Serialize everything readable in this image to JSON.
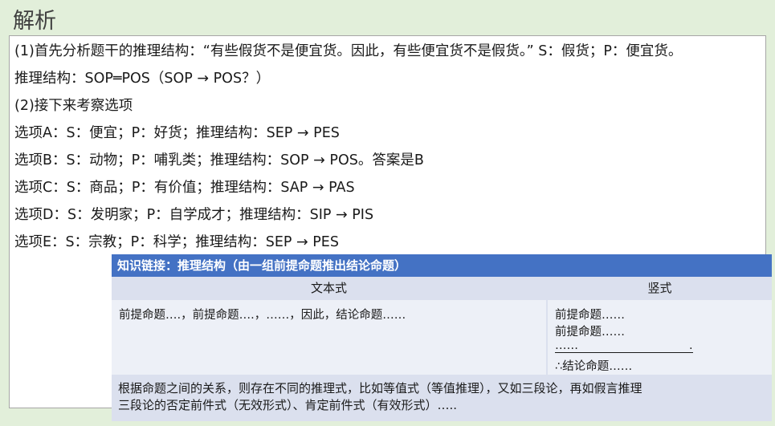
{
  "heading": "解析",
  "lines": [
    "(1)首先分析题干的推理结构：“有些假货不是便宜货。因此，有些便宜货不是假货。” S：假货；P：便宜货。",
    "推理结构：SOP═POS（SOP → POS？）",
    "(2)接下来考察选项",
    "选项A：S：便宜；P：好货；推理结构：SEP → PES",
    "选项B：S：动物；P：哺乳类；推理结构：SOP → POS。答案是B",
    "选项C：S：商品；P：有价值；推理结构：SAP → PAS",
    "选项D：S：发明家；P：自学成才；推理结构：SIP → PIS",
    "选项E：S：宗教；P：科学；推理结构：SEP → PES"
  ],
  "knowledge": {
    "title": "知识链接：推理结构（由一组前提命题推出结论命题）",
    "col1_header": "文本式",
    "col2_header": "竖式",
    "col1_text": "前提命题….，前提命题….，……，因此，结论命题……",
    "col2_lines": [
      "前提命题……",
      "前提命题……",
      "……",
      ".",
      "∴结论命题……"
    ],
    "footer_line1": "根据命题之间的关系，则存在不同的推理式，比如等值式（等值推理），又如三段论，再如假言推理",
    "footer_line2": "三段论的否定前件式（无效形式）、肯定前件式（有效形式）….."
  },
  "colors": {
    "background": "#e2efda",
    "title_bar": "#4472c4",
    "table_light": "#dbe0ee",
    "table_lighter": "#edf0f7"
  }
}
